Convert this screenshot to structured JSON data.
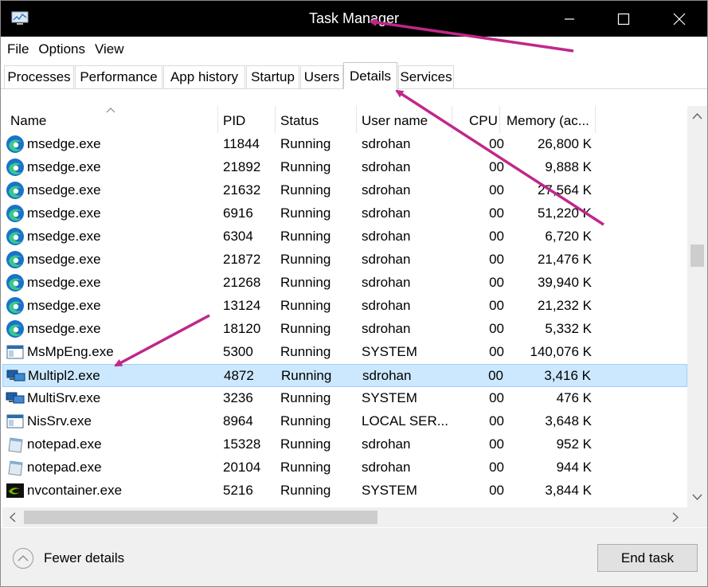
{
  "window": {
    "title": "Task Manager"
  },
  "menu": [
    "File",
    "Options",
    "View"
  ],
  "tabs": [
    "Processes",
    "Performance",
    "App history",
    "Startup",
    "Users",
    "Details",
    "Services"
  ],
  "active_tab": "Details",
  "columns": [
    "Name",
    "PID",
    "Status",
    "User name",
    "CPU",
    "Memory (ac..."
  ],
  "rows": [
    {
      "icon": "edge-icon",
      "name": "msedge.exe",
      "pid": "11844",
      "status": "Running",
      "user": "sdrohan",
      "cpu": "00",
      "mem": "26,800 K"
    },
    {
      "icon": "edge-icon",
      "name": "msedge.exe",
      "pid": "21892",
      "status": "Running",
      "user": "sdrohan",
      "cpu": "00",
      "mem": "9,888 K"
    },
    {
      "icon": "edge-icon",
      "name": "msedge.exe",
      "pid": "21632",
      "status": "Running",
      "user": "sdrohan",
      "cpu": "00",
      "mem": "27,564 K"
    },
    {
      "icon": "edge-icon",
      "name": "msedge.exe",
      "pid": "6916",
      "status": "Running",
      "user": "sdrohan",
      "cpu": "00",
      "mem": "51,220 K"
    },
    {
      "icon": "edge-icon",
      "name": "msedge.exe",
      "pid": "6304",
      "status": "Running",
      "user": "sdrohan",
      "cpu": "00",
      "mem": "6,720 K"
    },
    {
      "icon": "edge-icon",
      "name": "msedge.exe",
      "pid": "21872",
      "status": "Running",
      "user": "sdrohan",
      "cpu": "00",
      "mem": "21,476 K"
    },
    {
      "icon": "edge-icon",
      "name": "msedge.exe",
      "pid": "21268",
      "status": "Running",
      "user": "sdrohan",
      "cpu": "00",
      "mem": "39,940 K"
    },
    {
      "icon": "edge-icon",
      "name": "msedge.exe",
      "pid": "13124",
      "status": "Running",
      "user": "sdrohan",
      "cpu": "00",
      "mem": "21,232 K"
    },
    {
      "icon": "edge-icon",
      "name": "msedge.exe",
      "pid": "18120",
      "status": "Running",
      "user": "sdrohan",
      "cpu": "00",
      "mem": "5,332 K"
    },
    {
      "icon": "app-window-icon",
      "name": "MsMpEng.exe",
      "pid": "5300",
      "status": "Running",
      "user": "SYSTEM",
      "cpu": "00",
      "mem": "140,076 K"
    },
    {
      "icon": "monitors-icon",
      "name": "Multipl2.exe",
      "pid": "4872",
      "status": "Running",
      "user": "sdrohan",
      "cpu": "00",
      "mem": "3,416 K",
      "selected": true
    },
    {
      "icon": "monitors-icon",
      "name": "MultiSrv.exe",
      "pid": "3236",
      "status": "Running",
      "user": "SYSTEM",
      "cpu": "00",
      "mem": "476 K"
    },
    {
      "icon": "app-window-icon",
      "name": "NisSrv.exe",
      "pid": "8964",
      "status": "Running",
      "user": "LOCAL SER...",
      "cpu": "00",
      "mem": "3,648 K"
    },
    {
      "icon": "notepad-icon",
      "name": "notepad.exe",
      "pid": "15328",
      "status": "Running",
      "user": "sdrohan",
      "cpu": "00",
      "mem": "952 K"
    },
    {
      "icon": "notepad-icon",
      "name": "notepad.exe",
      "pid": "20104",
      "status": "Running",
      "user": "sdrohan",
      "cpu": "00",
      "mem": "944 K"
    },
    {
      "icon": "nvidia-icon",
      "name": "nvcontainer.exe",
      "pid": "5216",
      "status": "Running",
      "user": "SYSTEM",
      "cpu": "00",
      "mem": "3,844 K"
    }
  ],
  "footer": {
    "fewer_details": "Fewer details",
    "end_task": "End task"
  },
  "colors": {
    "selection": "#cce8ff",
    "selection_border": "#99d1ff",
    "annotation_arrow": "#c0278a",
    "edge_blue": "#1a73c9",
    "edge_green": "#38c98a"
  }
}
